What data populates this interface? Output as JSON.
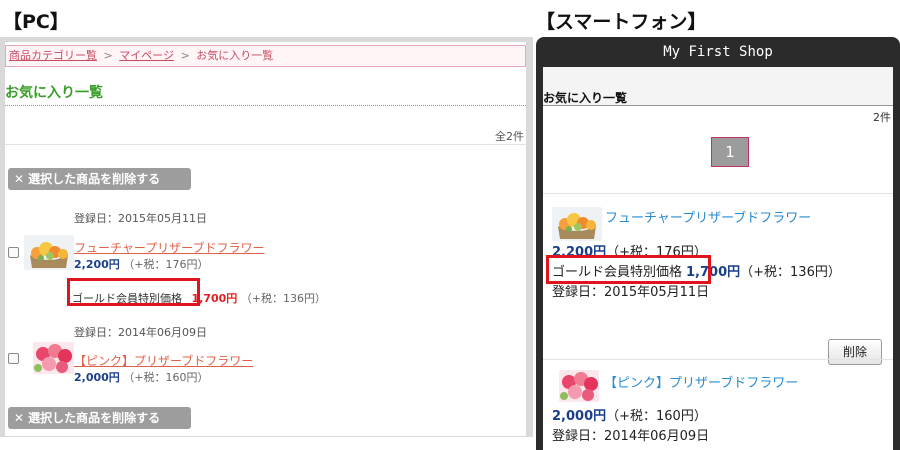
{
  "labels": {
    "pc": "【PC】",
    "smartphone": "【スマートフォン】"
  },
  "pc": {
    "breadcrumb": [
      {
        "label": "商品カテゴリー覧",
        "link": true
      },
      {
        "label": "マイページ",
        "link": true
      },
      {
        "label": "お気に入り一覧",
        "link": false
      }
    ],
    "breadcrumb_sep": ">",
    "title": "お気に入り一覧",
    "count": "全2件",
    "delete_selected_label": "選択した商品を削除する",
    "items": [
      {
        "date": "登録日：2015年05月11日",
        "name": "フューチャープリザーブドフラワー",
        "price": "2,200円",
        "tax": "（+税：176円）",
        "member_label": "ゴールド会員特別価格",
        "member_price": "1,700円",
        "member_tax": "（+税：136円）"
      },
      {
        "date": "登録日：2014年06月09日",
        "name": "【ピンク】プリザーブドフラワー",
        "price": "2,000円",
        "tax": "（+税：160円）"
      }
    ]
  },
  "sp": {
    "shop_name": "My First Shop",
    "title": "お気に入り一覧",
    "count": "2件",
    "page": "1",
    "delete_label": "削除",
    "items": [
      {
        "name": "フューチャープリザーブドフラワー",
        "price": "2,200円",
        "tax": "（+税：176円）",
        "member_label": "ゴールド会員特別価格",
        "member_price": "1,700円",
        "member_tax": "（+税：136円）",
        "date": "登録日：2015年05月11日"
      },
      {
        "name": "【ピンク】プリザーブドフラワー",
        "price": "2,000円",
        "tax": "（+税：160円）",
        "date": "登録日：2014年06月09日"
      }
    ]
  },
  "icons": {
    "delete": "close-icon",
    "product_1": "orange-flower-arrangement",
    "product_2": "pink-rose-arrangement"
  },
  "colors": {
    "highlight_box": "#e0141e",
    "pc_title": "#3a9e2a",
    "link": "#e0604a",
    "price": "#1a3f8a",
    "member_price": "#e02020",
    "sp_link": "#2a8ad0"
  }
}
